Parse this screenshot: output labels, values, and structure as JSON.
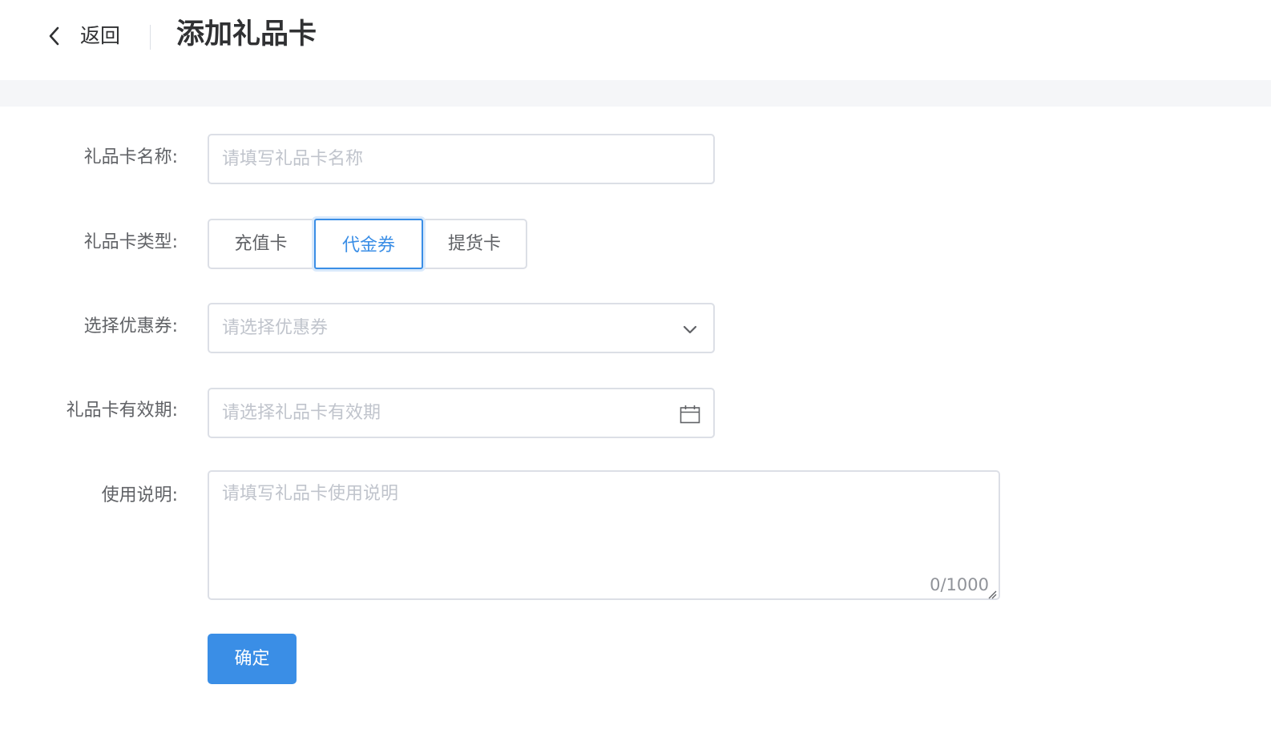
{
  "header": {
    "back_label": "返回",
    "title": "添加礼品卡"
  },
  "form": {
    "name": {
      "label": "礼品卡名称:",
      "placeholder": "请填写礼品卡名称"
    },
    "type": {
      "label": "礼品卡类型:",
      "options": [
        "充值卡",
        "代金券",
        "提货卡"
      ],
      "selected": "代金券"
    },
    "coupon": {
      "label": "选择优惠券:",
      "placeholder": "请选择优惠券",
      "icon": "chevron-down-icon"
    },
    "validity": {
      "label": "礼品卡有效期:",
      "placeholder": "请选择礼品卡有效期",
      "icon": "calendar-icon"
    },
    "usage": {
      "label": "使用说明:",
      "placeholder": "请填写礼品卡使用说明",
      "counter": "0/1000"
    },
    "submit_label": "确定"
  },
  "colors": {
    "accent": "#3a8ee6",
    "border": "#dcdfe6",
    "placeholder": "#c0c4cc",
    "band": "#f5f6f8"
  }
}
